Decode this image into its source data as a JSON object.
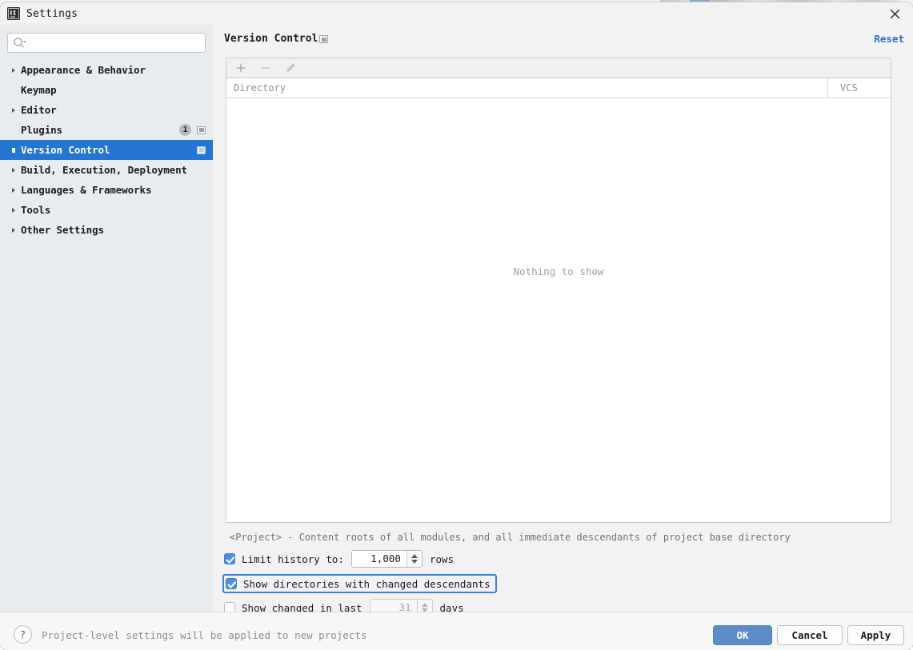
{
  "window": {
    "title": "Settings",
    "app_icon": "intellij-idea-icon",
    "close_icon": "close-icon"
  },
  "sidebar": {
    "search": {
      "placeholder": "",
      "value": "",
      "icon": "search-icon"
    },
    "items": [
      {
        "label": "Appearance & Behavior",
        "expandable": true,
        "selected": false,
        "badge": null,
        "panel_icon": false
      },
      {
        "label": "Keymap",
        "expandable": false,
        "selected": false,
        "badge": null,
        "panel_icon": false
      },
      {
        "label": "Editor",
        "expandable": true,
        "selected": false,
        "badge": null,
        "panel_icon": false
      },
      {
        "label": "Plugins",
        "expandable": false,
        "selected": false,
        "badge": "1",
        "panel_icon": true
      },
      {
        "label": "Version Control",
        "expandable": true,
        "selected": true,
        "badge": null,
        "panel_icon": true
      },
      {
        "label": "Build, Execution, Deployment",
        "expandable": true,
        "selected": false,
        "badge": null,
        "panel_icon": false
      },
      {
        "label": "Languages & Frameworks",
        "expandable": true,
        "selected": false,
        "badge": null,
        "panel_icon": false
      },
      {
        "label": "Tools",
        "expandable": true,
        "selected": false,
        "badge": null,
        "panel_icon": false
      },
      {
        "label": "Other Settings",
        "expandable": true,
        "selected": false,
        "badge": null,
        "panel_icon": false
      }
    ]
  },
  "main": {
    "page_title": "Version Control",
    "page_title_icon": "project-settings-icon",
    "reset_label": "Reset",
    "toolbar": {
      "add_icon": "plus-icon",
      "remove_icon": "minus-icon",
      "edit_icon": "pencil-icon"
    },
    "table": {
      "columns": [
        "Directory",
        "VCS"
      ],
      "rows": [],
      "empty_text": "Nothing to show"
    },
    "hint": "<Project> - Content roots of all modules, and all immediate descendants of project base directory",
    "options": [
      {
        "id": "limit-history",
        "checked": true,
        "label": "Limit history to:",
        "spinner_value": "1,000",
        "suffix": "rows",
        "enabled": true,
        "focused": false
      },
      {
        "id": "show-changed-descendants",
        "checked": true,
        "label": "Show directories with changed descendants",
        "spinner_value": null,
        "suffix": null,
        "enabled": true,
        "focused": true
      },
      {
        "id": "show-changed-in-last",
        "checked": false,
        "label": "Show changed in last",
        "spinner_value": "31",
        "suffix": "days",
        "enabled": false,
        "focused": false
      }
    ]
  },
  "footer": {
    "help_icon": "help-icon",
    "help_label": "?",
    "note": "Project-level settings will be applied to new projects",
    "ok_label": "OK",
    "cancel_label": "Cancel",
    "apply_label": "Apply"
  },
  "colors": {
    "selection_blue": "#2675d0",
    "link_blue": "#2f6fc4",
    "ok_button_blue": "#5b8cc8",
    "checkbox_blue": "#4a90e2",
    "focus_ring_blue": "#3b82e0",
    "sidebar_bg": "#e8ecef",
    "dialog_bg": "#f2f2f2"
  }
}
